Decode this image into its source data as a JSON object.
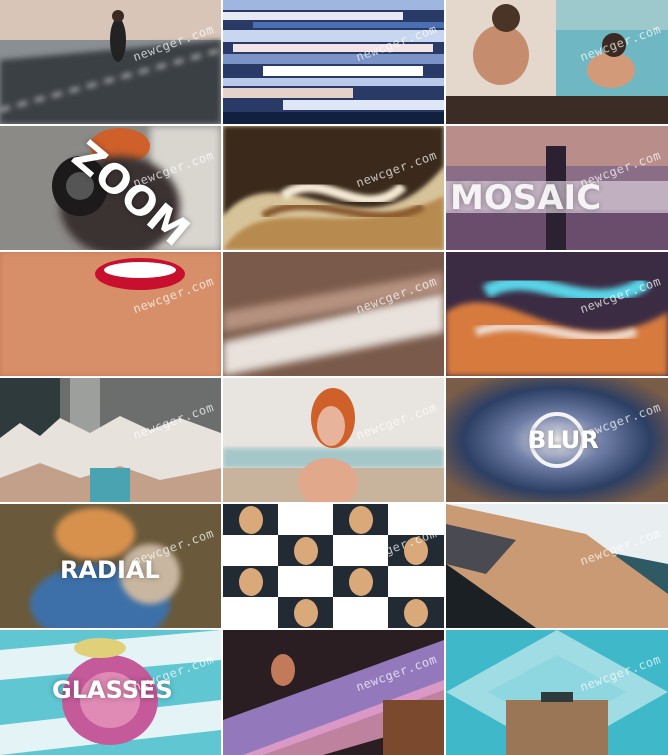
{
  "watermark": "newcger.com",
  "overlay_text": {
    "zoom": "ZOOM",
    "mosaic": "MOSAIC",
    "blur": "BLUR",
    "radial": "RADIAL",
    "glasses": "GLASSES"
  },
  "colors": {
    "lipstick": "#c8102e",
    "hair_orange": "#d0602a",
    "teal": "#3fb8c9",
    "pink": "#d87aa6",
    "sand": "#c99a73"
  }
}
